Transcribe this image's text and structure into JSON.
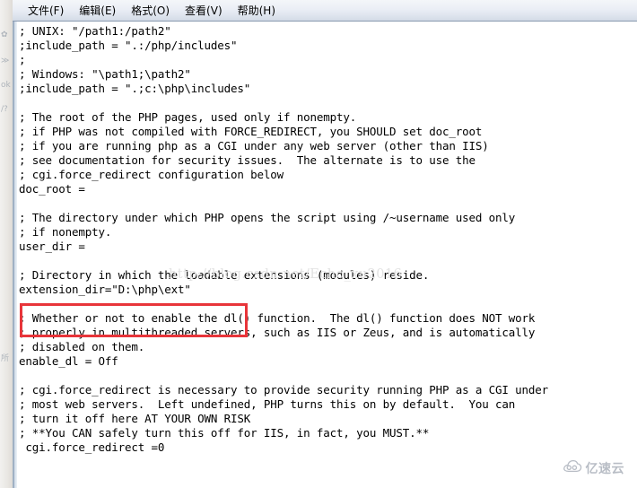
{
  "window": {
    "app": "notepad",
    "menu": [
      {
        "label": "文件(F)",
        "name": "menu-file"
      },
      {
        "label": "编辑(E)",
        "name": "menu-edit"
      },
      {
        "label": "格式(O)",
        "name": "menu-format"
      },
      {
        "label": "查看(V)",
        "name": "menu-view"
      },
      {
        "label": "帮助(H)",
        "name": "menu-help"
      }
    ]
  },
  "editor": {
    "lines": [
      "; UNIX: \"/path1:/path2\"",
      ";include_path = \".:/php/includes\"",
      ";",
      "; Windows: \"\\path1;\\path2\"",
      ";include_path = \".;c:\\php\\includes\"",
      "",
      "; The root of the PHP pages, used only if nonempty.",
      "; if PHP was not compiled with FORCE_REDIRECT, you SHOULD set doc_root",
      "; if you are running php as a CGI under any web server (other than IIS)",
      "; see documentation for security issues.  The alternate is to use the",
      "; cgi.force_redirect configuration below",
      "doc_root =",
      "",
      "; The directory under which PHP opens the script using /~username used only",
      "; if nonempty.",
      "user_dir =",
      "",
      "; Directory in which the loadable extensions (modules) reside.",
      "extension_dir=\"D:\\php\\ext\"",
      "",
      "; Whether or not to enable the dl() function.  The dl() function does NOT work",
      "; properly in multithreaded servers, such as IIS or Zeus, and is automatically",
      "; disabled on them.",
      "enable_dl = Off",
      "",
      "; cgi.force_redirect is necessary to provide security running PHP as a CGI under",
      "; most web servers.  Left undefined, PHP turns this on by default.  You can",
      "; turn it off here AT YOUR OWN RISK",
      "; **You CAN safely turn this off for IIS, in fact, you MUST.**",
      " cgi.force_redirect =0"
    ]
  },
  "annotation": {
    "color": "#e8353a",
    "target_text": "extension_dir=\"D:\\php\\ext\""
  },
  "watermarks": {
    "url": "http://blog.csdn.net/Echo_xu2016",
    "logo_text": "亿速云",
    "logo_icon": "cloud-icon"
  },
  "background_strip": {
    "ghost_marks": [
      "✿",
      "≫",
      "ok",
      "/?",
      "所"
    ]
  }
}
